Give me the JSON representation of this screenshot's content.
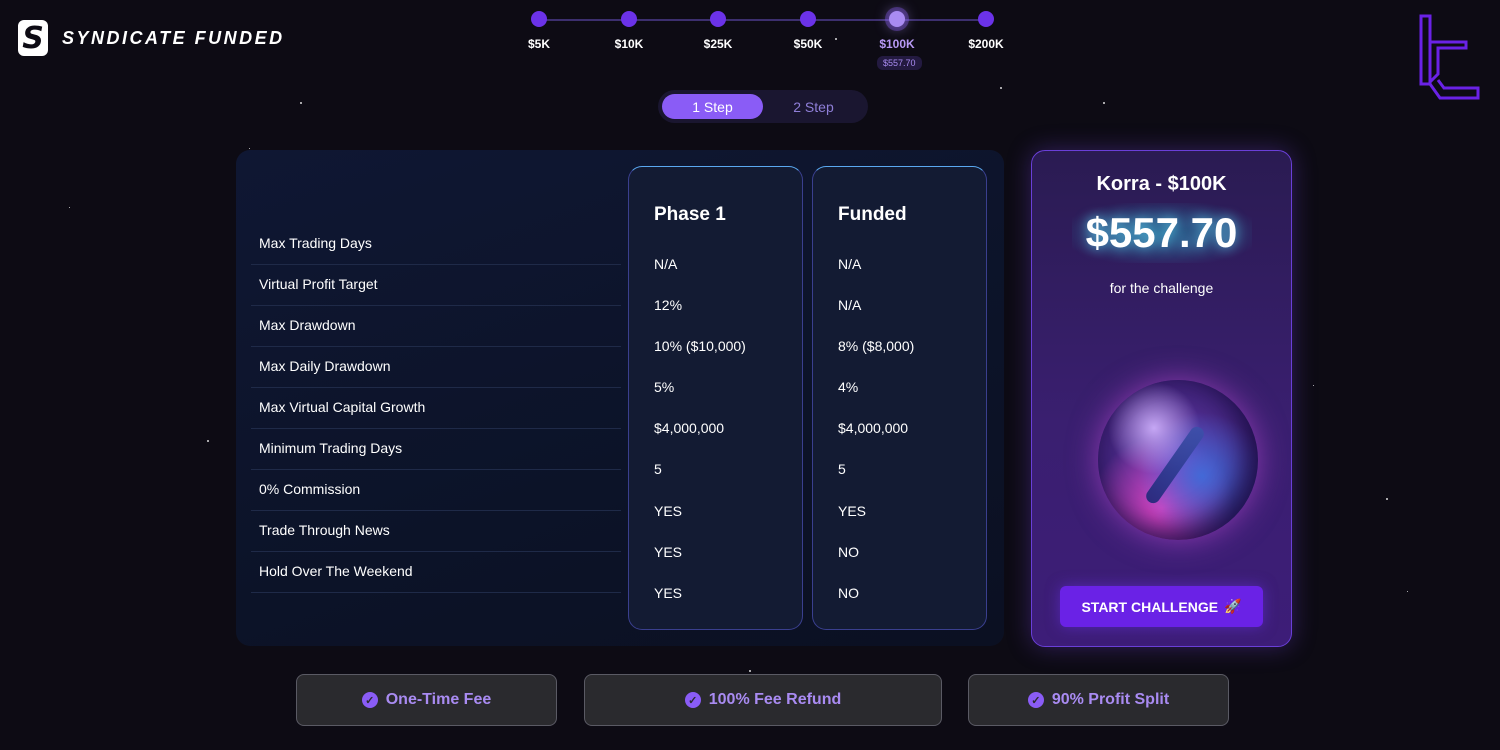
{
  "brand": {
    "name": "SYNDICATE FUNDED",
    "mark": "S"
  },
  "slider": {
    "stops": [
      "$5K",
      "$10K",
      "$25K",
      "$50K",
      "$100K",
      "$200K"
    ],
    "active_price": "$557.70"
  },
  "steps": {
    "one": "1 Step",
    "two": "2 Step"
  },
  "table": {
    "rows": [
      "Max Trading Days",
      "Virtual Profit Target",
      "Max Drawdown",
      "Max Daily Drawdown",
      "Max Virtual Capital Growth",
      "Minimum Trading Days",
      "0% Commission",
      "Trade Through News",
      "Hold Over The Weekend"
    ],
    "columns": [
      {
        "title": "Phase 1",
        "values": [
          "N/A",
          "12%",
          "10% ($10,000)",
          "5%",
          "$4,000,000",
          "5",
          "YES",
          "YES",
          "YES"
        ]
      },
      {
        "title": "Funded",
        "values": [
          "N/A",
          "N/A",
          "8% ($8,000)",
          "4%",
          "$4,000,000",
          "5",
          "YES",
          "NO",
          "NO"
        ]
      }
    ]
  },
  "card": {
    "title": "Korra - $100K",
    "price": "$557.70",
    "subtitle": "for the challenge",
    "button": "START CHALLENGE",
    "button_icon": "🚀"
  },
  "features": [
    "One-Time Fee",
    "100% Fee Refund",
    "90% Profit Split"
  ],
  "colors": {
    "accent": "#8a5cf6",
    "button": "#6a22e6",
    "bg": "#0d0b14"
  }
}
